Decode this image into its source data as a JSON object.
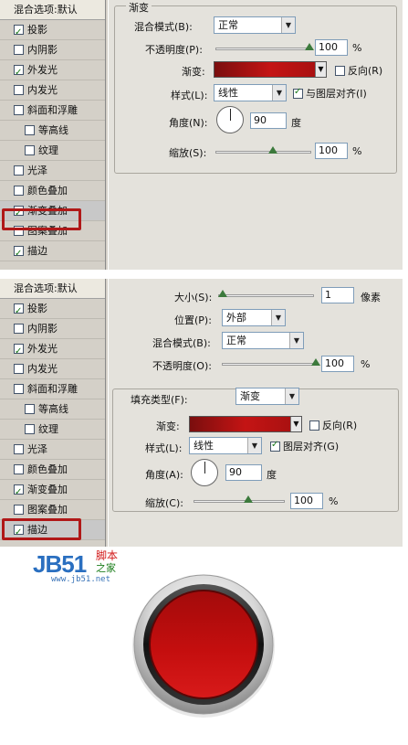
{
  "sidebar": {
    "title": "混合选项:默认",
    "items": [
      {
        "label": "投影",
        "checked": true,
        "indent": false
      },
      {
        "label": "内阴影",
        "checked": false,
        "indent": false
      },
      {
        "label": "外发光",
        "checked": true,
        "indent": false
      },
      {
        "label": "内发光",
        "checked": false,
        "indent": false
      },
      {
        "label": "斜面和浮雕",
        "checked": false,
        "indent": false
      },
      {
        "label": "等高线",
        "checked": false,
        "indent": true
      },
      {
        "label": "纹理",
        "checked": false,
        "indent": true
      },
      {
        "label": "光泽",
        "checked": false,
        "indent": false
      },
      {
        "label": "颜色叠加",
        "checked": false,
        "indent": false
      },
      {
        "label": "渐变叠加",
        "checked": true,
        "indent": false
      },
      {
        "label": "图案叠加",
        "checked": false,
        "indent": false
      },
      {
        "label": "描边",
        "checked": true,
        "indent": false
      }
    ]
  },
  "panel1": {
    "group_title": "渐变",
    "blend_mode_label": "混合模式(B):",
    "blend_mode_value": "正常",
    "opacity_label": "不透明度(P):",
    "opacity_value": "100",
    "opacity_pct": 1.0,
    "gradient_label": "渐变:",
    "reverse_label": "反向(R)",
    "style_label": "样式(L):",
    "style_value": "线性",
    "align_label": "与图层对齐(I)",
    "angle_label": "角度(N):",
    "angle_value": "90",
    "angle_unit": "度",
    "scale_label": "缩放(S):",
    "scale_value": "100",
    "scale_pct": 0.5,
    "percent": "%"
  },
  "panel2": {
    "size_label": "大小(S):",
    "size_value": "1",
    "size_unit": "像素",
    "position_label": "位置(P):",
    "position_value": "外部",
    "blend_mode_label": "混合模式(B):",
    "blend_mode_value": "正常",
    "opacity_label": "不透明度(O):",
    "opacity_value": "100",
    "fill_type_label": "填充类型(F):",
    "fill_type_value": "渐变",
    "gradient_label": "渐变:",
    "reverse_label": "反向(R)",
    "style_label": "样式(L):",
    "style_value": "线性",
    "align_label": "图层对齐(G)",
    "angle_label": "角度(A):",
    "angle_value": "90",
    "angle_unit": "度",
    "scale_label": "缩放(C):",
    "scale_value": "100",
    "percent": "%"
  },
  "logo": {
    "text": "JB51",
    "cn_line1": "脚本",
    "cn_line2": "之家",
    "url": "www.jb51.net"
  },
  "colors": {
    "button_red": "#c00a0a",
    "highlight_box": "#b01818"
  }
}
